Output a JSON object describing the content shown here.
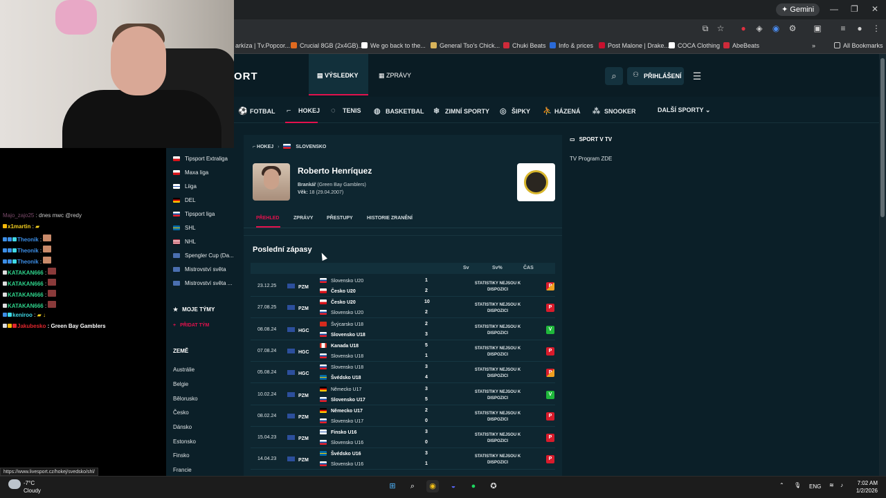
{
  "browser": {
    "gemini_label": "Gemini",
    "bookmarks": [
      {
        "label": "arkíza | Tv.Popcor...",
        "color": "#3aa0e0"
      },
      {
        "label": "Crucial 8GB (2x4GB)...",
        "color": "#e06a1f"
      },
      {
        "label": "We go back to the...",
        "color": "#ffffff"
      },
      {
        "label": "General Tso's Chick...",
        "color": "#d8b35a"
      },
      {
        "label": "Chuki Beats",
        "color": "#cf2a3a"
      },
      {
        "label": "Info & prices",
        "color": "#2a6ad8"
      },
      {
        "label": "Post Malone | Drake...",
        "color": "#c8102e"
      },
      {
        "label": "COCA Clothing",
        "color": "#ffffff"
      },
      {
        "label": "AbeBeats",
        "color": "#cf2a3a"
      }
    ],
    "all_bookmarks": "All Bookmarks",
    "status_url": "https://www.livesport.cz/hokej/svedsko/shl/"
  },
  "site": {
    "logo": "ORT",
    "header_tabs": [
      "VÝSLEDKY",
      "ZPRÁVY"
    ],
    "login": "PŘIHLÁŠENÍ",
    "sports": [
      "FOTBAL",
      "HOKEJ",
      "TENIS",
      "BASKETBAL",
      "ZIMNÍ SPORTY",
      "ŠIPKY",
      "HÁZENÁ",
      "SNOOKER",
      "DALŠÍ SPORTY"
    ]
  },
  "sidebar": {
    "leagues": [
      {
        "label": "Tipsport Extraliga",
        "flag": "cz"
      },
      {
        "label": "Maxa liga",
        "flag": "cz"
      },
      {
        "label": "Liiga",
        "flag": "fi"
      },
      {
        "label": "DEL",
        "flag": "de"
      },
      {
        "label": "Tipsport liga",
        "flag": "sk"
      },
      {
        "label": "SHL",
        "flag": "se"
      },
      {
        "label": "NHL",
        "flag": "us"
      },
      {
        "label": "Spengler Cup (Da...",
        "flag": "world"
      },
      {
        "label": "Mistrovství světa",
        "flag": "world"
      },
      {
        "label": "Mistrovství světa ...",
        "flag": "world"
      }
    ],
    "my_teams": "MOJE TÝMY",
    "add_team": "PŘIDAT TÝM",
    "countries_title": "ZEMĚ",
    "countries": [
      "Austrálie",
      "Belgie",
      "Bělorusko",
      "Česko",
      "Dánsko",
      "Estonsko",
      "Finsko",
      "Francie"
    ]
  },
  "chat": [
    {
      "user": "Majo_zajo25",
      "msg": "dnes mwc @redy",
      "color": "#7a4a6a"
    },
    {
      "user": "x1martin",
      "msg": "",
      "color": "#f5d020"
    },
    {
      "user": "Theonik",
      "msg": "",
      "color": "#3c8ee6"
    },
    {
      "user": "Theonik",
      "msg": "",
      "color": "#3c8ee6"
    },
    {
      "user": "Theonik",
      "msg": "",
      "color": "#3c8ee6"
    },
    {
      "user": "KATAKAN666",
      "msg": "",
      "color": "#2ed18a"
    },
    {
      "user": "KATAKAN666",
      "msg": "",
      "color": "#2ed18a"
    },
    {
      "user": "KATAKAN666",
      "msg": "",
      "color": "#2ed18a"
    },
    {
      "user": "KATAKAN666",
      "msg": "",
      "color": "#2ed18a"
    },
    {
      "user": "keniroo",
      "msg": "",
      "color": "#3fd9e6"
    },
    {
      "user": "Jakubesko",
      "msg": "Green Bay Gamblers",
      "color": "#e0262d"
    }
  ],
  "breadcrumb": {
    "sport": "HOKEJ",
    "country": "SLOVENSKO"
  },
  "player": {
    "name": "Roberto Henríquez",
    "position": "Brankář",
    "team": "(Green Bay Gamblers)",
    "age_label": "Věk:",
    "age": "18 (29.04.2007)"
  },
  "player_tabs": [
    "PŘEHLED",
    "ZPRÁVY",
    "PŘESTUPY",
    "HISTORIE ZRANĚNÍ"
  ],
  "matches": {
    "title": "Poslední zápasy",
    "columns": [
      "Sv",
      "Sv%",
      "ČAS"
    ],
    "stats_text": "STATISTIKY NEJSOU K DISPOZICI",
    "rows": [
      {
        "date": "23.12.25",
        "type": "PZM",
        "home": "Slovensko U20",
        "away": "Česko U20",
        "home_flag": "sk",
        "away_flag": "cz",
        "hs": "1",
        "as": "2",
        "winner": "away",
        "result": "P"
      },
      {
        "date": "27.08.25",
        "type": "PZM",
        "home": "Česko U20",
        "away": "Slovensko U20",
        "home_flag": "cz",
        "away_flag": "sk",
        "hs": "10",
        "as": "2",
        "winner": "home",
        "result": "P"
      },
      {
        "date": "08.08.24",
        "type": "HGC",
        "home": "Švýcarsko U18",
        "away": "Slovensko U18",
        "home_flag": "ch",
        "away_flag": "sk",
        "hs": "2",
        "as": "3",
        "winner": "away",
        "result": "V"
      },
      {
        "date": "07.08.24",
        "type": "HGC",
        "home": "Kanada U18",
        "away": "Slovensko U18",
        "home_flag": "ca",
        "away_flag": "sk",
        "hs": "5",
        "as": "1",
        "winner": "home",
        "result": "P"
      },
      {
        "date": "05.08.24",
        "type": "HGC",
        "home": "Slovensko U18",
        "away": "Švédsko U18",
        "home_flag": "sk",
        "away_flag": "se",
        "hs": "3",
        "as": "4",
        "winner": "away",
        "result": "P"
      },
      {
        "date": "10.02.24",
        "type": "PZM",
        "home": "Německo U17",
        "away": "Slovensko U17",
        "home_flag": "de",
        "away_flag": "sk",
        "hs": "3",
        "as": "5",
        "winner": "away",
        "result": "V"
      },
      {
        "date": "08.02.24",
        "type": "PZM",
        "home": "Německo U17",
        "away": "Slovensko U17",
        "home_flag": "de",
        "away_flag": "sk",
        "hs": "2",
        "as": "0",
        "winner": "home",
        "result": "P"
      },
      {
        "date": "15.04.23",
        "type": "PZM",
        "home": "Finsko U16",
        "away": "Slovensko U16",
        "home_flag": "fi",
        "away_flag": "sk",
        "hs": "3",
        "as": "0",
        "winner": "home",
        "result": "P"
      },
      {
        "date": "14.04.23",
        "type": "PZM",
        "home": "Švédsko U16",
        "away": "Slovensko U16",
        "home_flag": "se",
        "away_flag": "sk",
        "hs": "3",
        "as": "1",
        "winner": "home",
        "result": "P"
      }
    ]
  },
  "right_panel": {
    "title": "SPORT V TV",
    "link": "TV Program ZDE"
  },
  "taskbar": {
    "temp": "-7°C",
    "weather": "Cloudy",
    "lang": "ENG",
    "time": "7:02 AM",
    "date": "1/2/2026"
  }
}
